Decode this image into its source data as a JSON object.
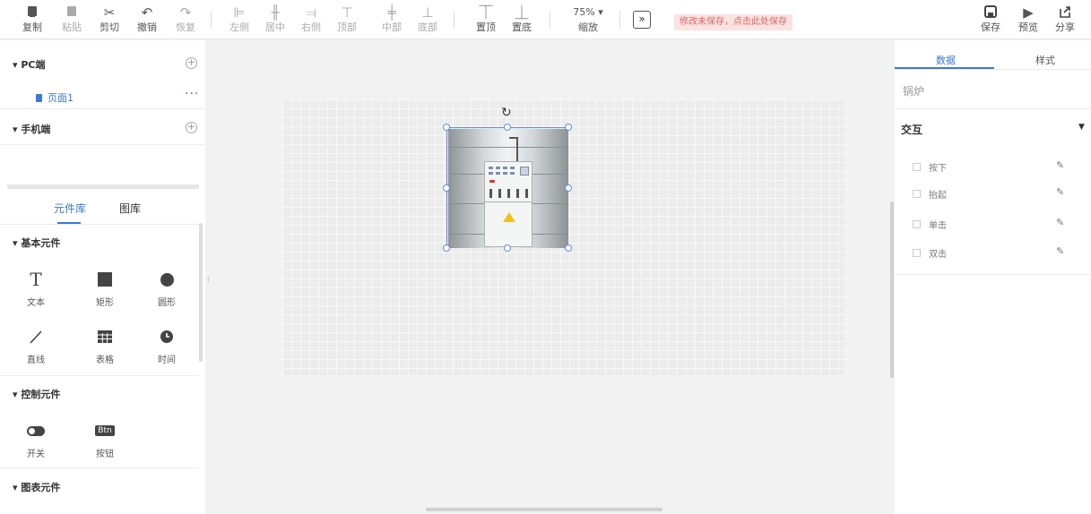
{
  "toolbar": {
    "copy": "复制",
    "paste": "粘贴",
    "cut": "剪切",
    "undo": "撤销",
    "redo": "恢复",
    "align_left": "左侧",
    "align_center": "居中",
    "align_right": "右侧",
    "align_top": "顶部",
    "align_middle": "中部",
    "align_bottom": "底部",
    "bring_top": "置顶",
    "send_bottom": "置底",
    "zoom_value": "75% ▾",
    "zoom_label": "缩放",
    "unsaved_notice": "修改未保存，点击此处保存",
    "save": "保存",
    "preview": "预览",
    "share": "分享"
  },
  "left_panel": {
    "pc_section": "PC端",
    "pages": [
      {
        "label": "页面1"
      }
    ],
    "more": "···",
    "mobile_section": "手机端",
    "tabs": [
      "元件库",
      "图库"
    ],
    "basic_section": "基本元件",
    "basic_components": [
      "文本",
      "矩形",
      "圆形",
      "直线",
      "表格",
      "时间"
    ],
    "control_section": "控制元件",
    "control_components": [
      "开关",
      "按钮"
    ],
    "button_icon_text": "Btn",
    "chart_section": "图表元件",
    "text_icon_glyph": "T"
  },
  "canvas": {
    "selected_element": "锅炉",
    "rotate_glyph": "↻"
  },
  "right_panel": {
    "tabs": [
      "数据",
      "样式"
    ],
    "element_name": "锅炉",
    "interaction_section": "交互",
    "events": [
      "按下",
      "抬起",
      "单击",
      "双击"
    ]
  },
  "colors": {
    "accent": "#3a7bd5",
    "selection": "#5b8def",
    "unsaved_bg": "#fde2e2",
    "unsaved_text": "#e06666",
    "warning_yellow": "#f4c020"
  }
}
